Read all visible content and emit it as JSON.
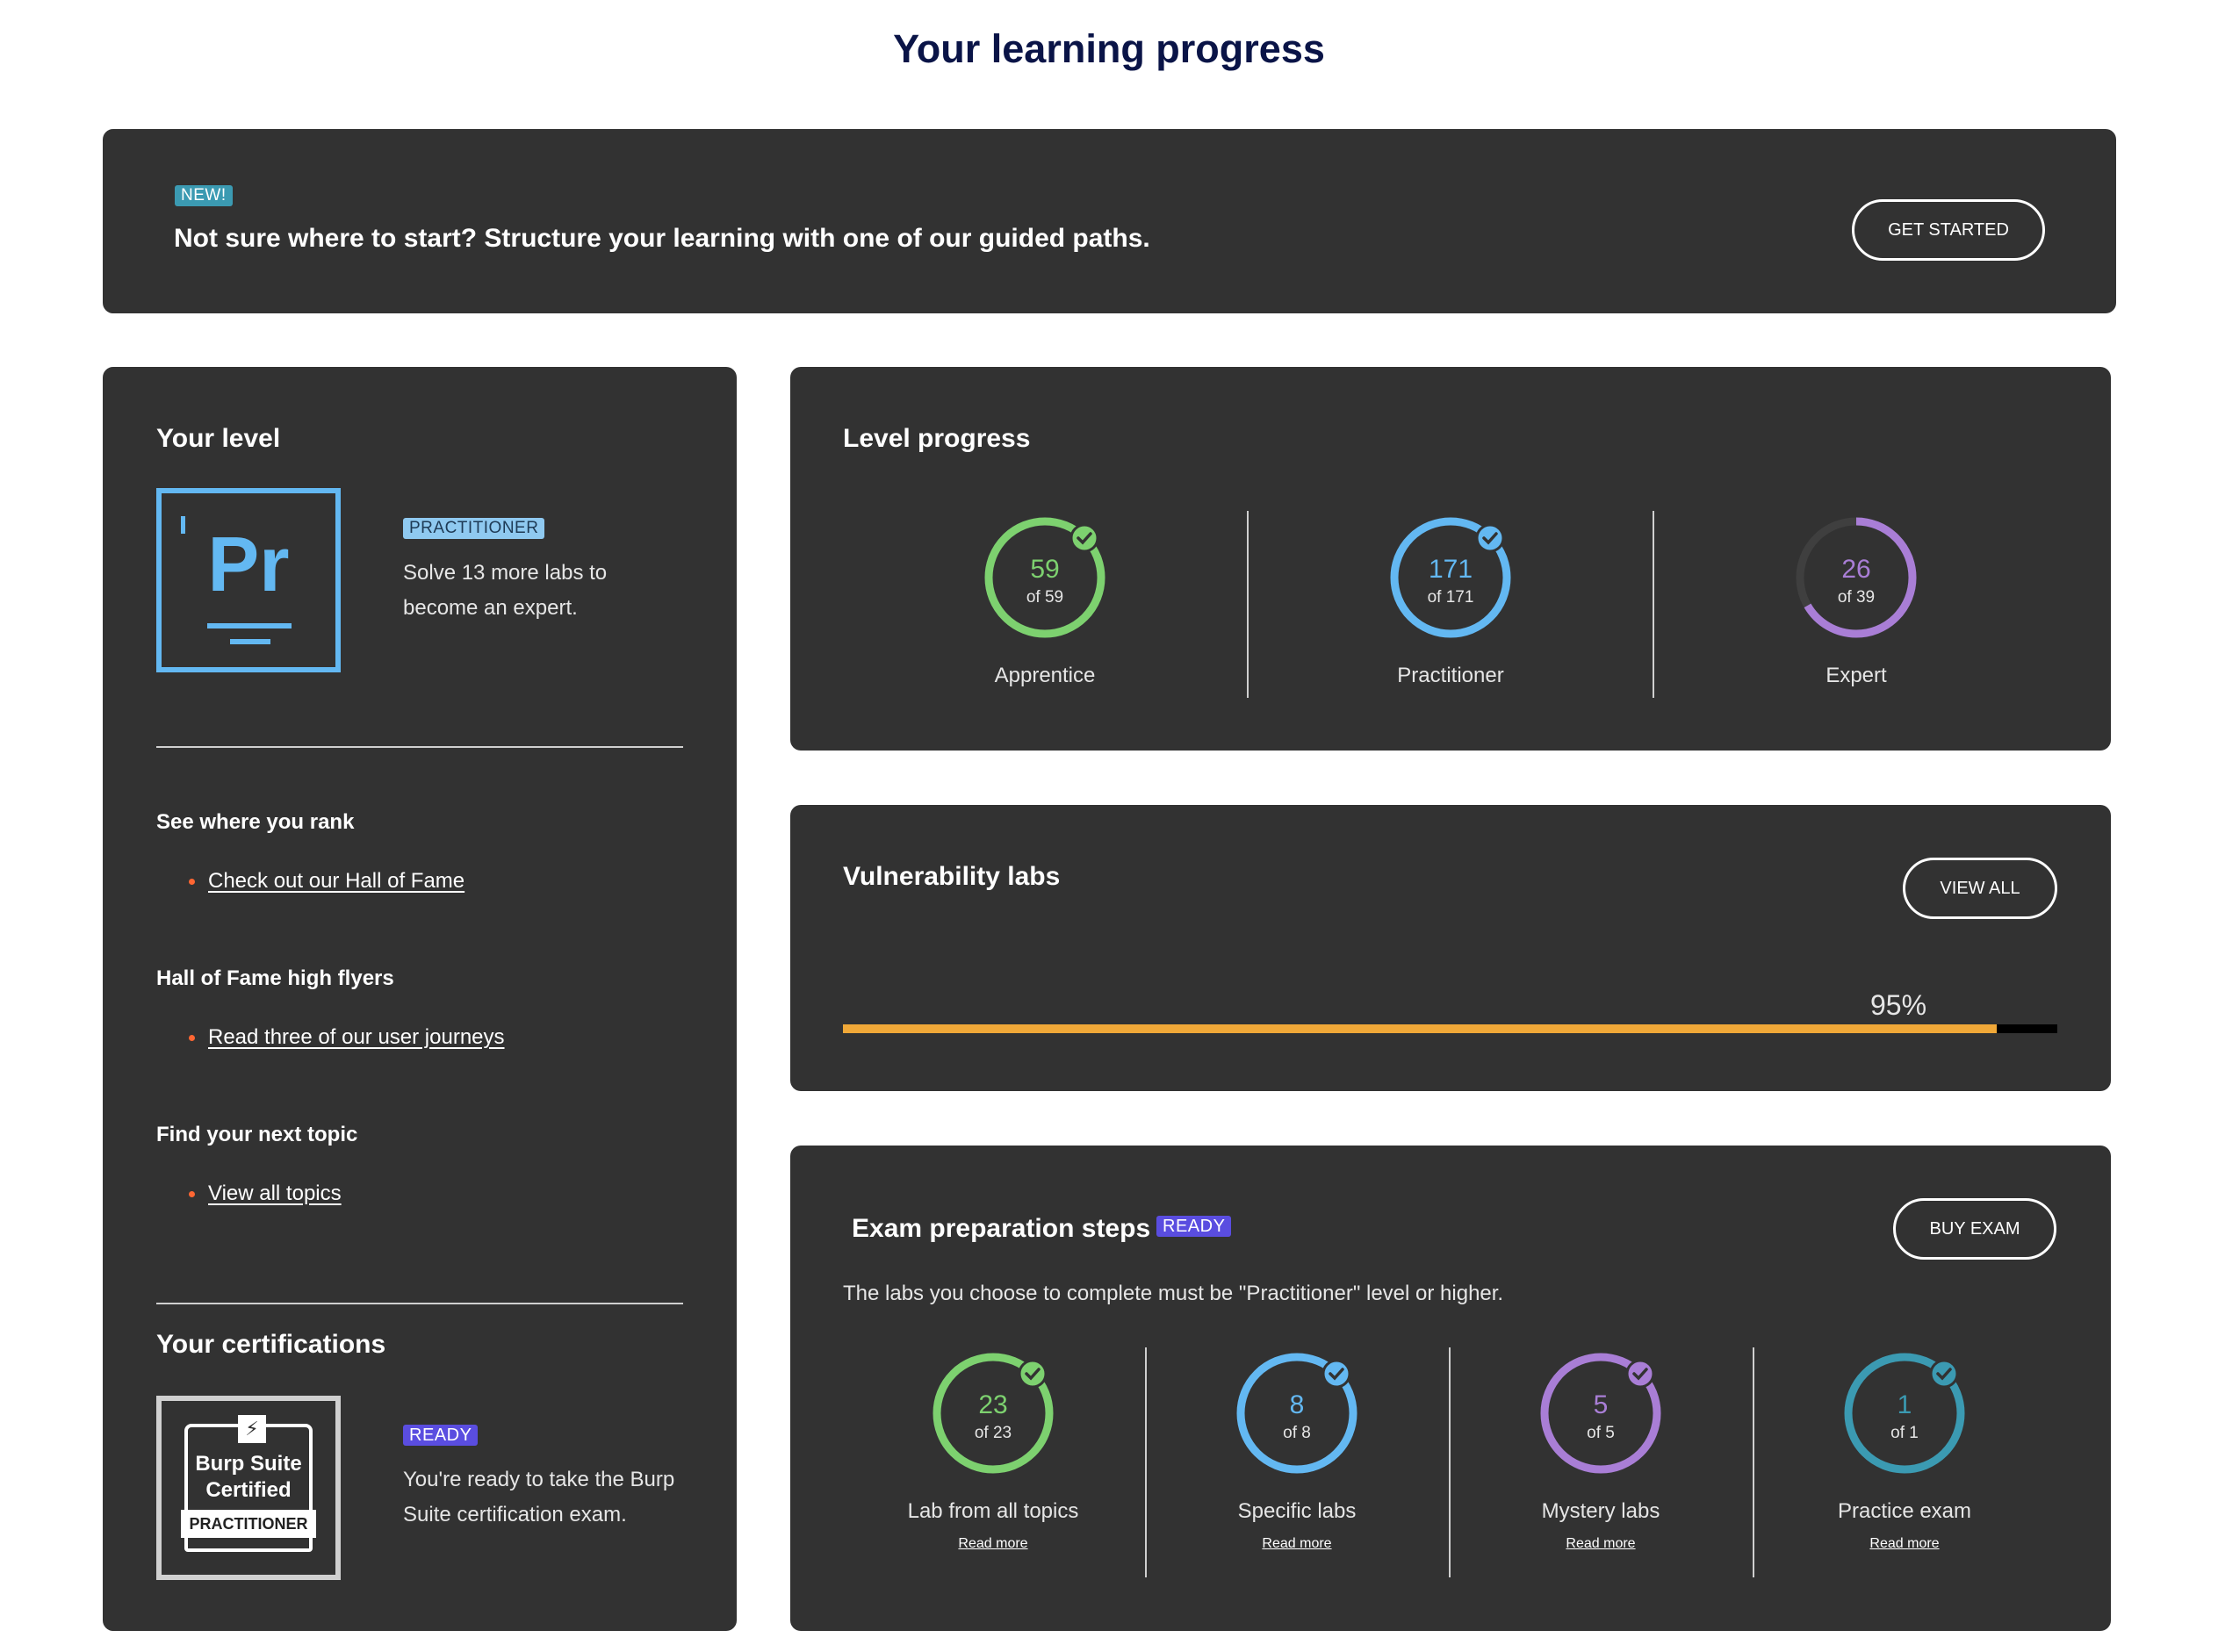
{
  "page": {
    "title": "Your learning progress"
  },
  "banner": {
    "badge": "NEW!",
    "text": "Not sure where to start? Structure your learning with one of our guided paths.",
    "button": "GET STARTED"
  },
  "your_level": {
    "title": "Your level",
    "logo_letters": "Pr",
    "badge": "PRACTITIONER",
    "description": "Solve 13 more labs to become an expert.",
    "sections": [
      {
        "heading": "See where you rank",
        "link": "Check out our Hall of Fame"
      },
      {
        "heading": "Hall of Fame high flyers",
        "link": "Read three of our user journeys"
      },
      {
        "heading": "Find your next topic",
        "link": "View all topics"
      }
    ]
  },
  "certifications": {
    "title": "Your certifications",
    "badge_line1": "Burp Suite",
    "badge_line2": "Certified",
    "badge_plate": "PRACTITIONER",
    "status": "READY",
    "description": "You're ready to take the Burp Suite certification exam."
  },
  "level_progress": {
    "title": "Level progress",
    "items": [
      {
        "label": "Apprentice",
        "value": "59",
        "of": "of 59",
        "done": 59,
        "total": 59,
        "color": "#7dd16f",
        "check": true
      },
      {
        "label": "Practitioner",
        "value": "171",
        "of": "of 171",
        "done": 171,
        "total": 171,
        "color": "#63b8f2",
        "check": true
      },
      {
        "label": "Expert",
        "value": "26",
        "of": "of 39",
        "done": 26,
        "total": 39,
        "color": "#a97ed6",
        "check": false
      }
    ]
  },
  "vulnerability_labs": {
    "title": "Vulnerability labs",
    "button": "VIEW ALL",
    "percent_label": "95%",
    "progress": 0.95,
    "bar_color": "#f0a838"
  },
  "exam_prep": {
    "title": "Exam preparation steps",
    "status": "READY",
    "button": "BUY EXAM",
    "description": "The labs you choose to complete must be \"Practitioner\" level or higher.",
    "read_more": "Read more",
    "items": [
      {
        "label": "Lab from all topics",
        "value": "23",
        "of": "of 23",
        "done": 23,
        "total": 23,
        "color": "#7dd16f",
        "check": true
      },
      {
        "label": "Specific labs",
        "value": "8",
        "of": "of 8",
        "done": 8,
        "total": 8,
        "color": "#63b8f2",
        "check": true
      },
      {
        "label": "Mystery labs",
        "value": "5",
        "of": "of 5",
        "done": 5,
        "total": 5,
        "color": "#a97ed6",
        "check": true
      },
      {
        "label": "Practice exam",
        "value": "1",
        "of": "of 1",
        "done": 1,
        "total": 1,
        "color": "#3b9ab2",
        "check": true
      }
    ]
  },
  "icons": {
    "check": "check-circle-icon",
    "bolt": "lightning-bolt-icon",
    "bullet": "bullet-dot-icon"
  }
}
